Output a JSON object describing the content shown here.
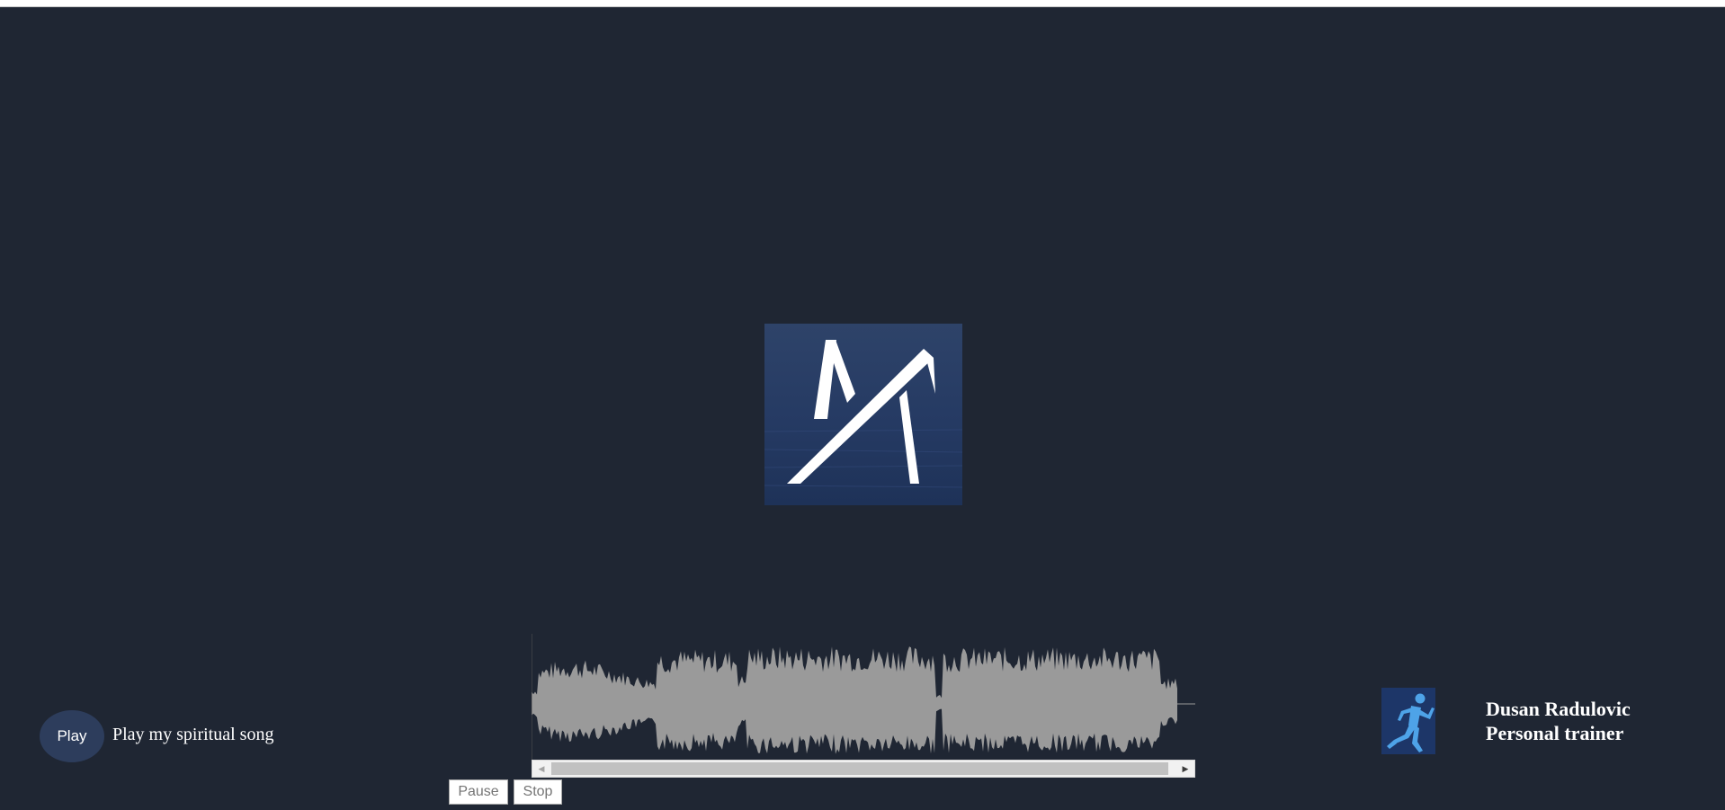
{
  "player": {
    "play_label": "Play",
    "song_label": "Play my spiritual song",
    "pause_label": "Pause",
    "stop_label": "Stop"
  },
  "profile": {
    "name": "Dusan Radulovic",
    "role": "Personal trainer"
  },
  "colors": {
    "background": "#1f2633",
    "play_button": "#2d3d5c",
    "waveform": "#9a9a9a",
    "logo_background": "#2a3e66",
    "runner_icon": "#4ea3e8"
  },
  "icons": {
    "logo": "monogram-logo",
    "runner": "running-person-icon",
    "scroll_left": "scroll-left-arrow-icon",
    "scroll_right": "scroll-right-arrow-icon"
  }
}
